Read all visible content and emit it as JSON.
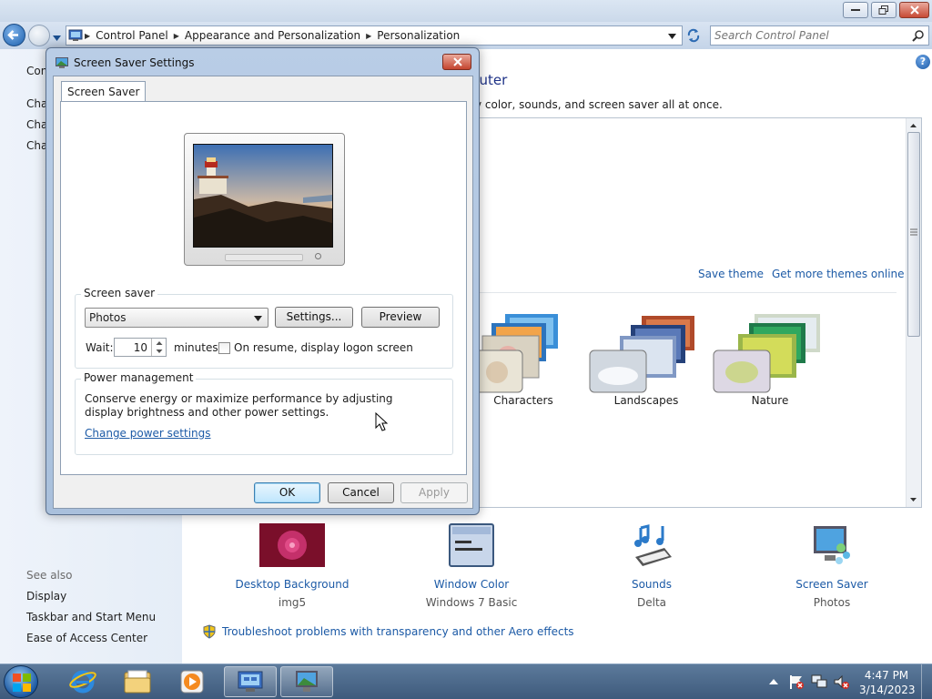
{
  "explorer": {
    "breadcrumbs": [
      "Control Panel",
      "Appearance and Personalization",
      "Personalization"
    ],
    "search_placeholder": "Search Control Panel",
    "left_links": [
      "Con",
      "Cha",
      "Cha",
      "Cha"
    ],
    "see_also": {
      "heading": "See also",
      "links": [
        "Display",
        "Taskbar and Start Menu",
        "Ease of Access Center"
      ]
    },
    "heading_partial": "puter",
    "subheading_partial": "v color, sounds, and screen saver all at once.",
    "save_theme": "Save theme",
    "get_more_themes": "Get more themes online",
    "themes": [
      {
        "label": "Characters"
      },
      {
        "label": "Landscapes"
      },
      {
        "label": "Nature"
      }
    ],
    "bottom_items": [
      {
        "label": "Desktop Background",
        "value": "img5"
      },
      {
        "label": "Window Color",
        "value": "Windows 7 Basic"
      },
      {
        "label": "Sounds",
        "value": "Delta"
      },
      {
        "label": "Screen Saver",
        "value": "Photos"
      }
    ],
    "troubleshoot_link": "Troubleshoot problems with transparency and other Aero effects"
  },
  "dialog": {
    "title": "Screen Saver Settings",
    "tab": "Screen Saver",
    "screensaver_group": "Screen saver",
    "selected_screensaver": "Photos",
    "settings_button": "Settings...",
    "preview_button": "Preview",
    "wait_label": "Wait:",
    "wait_value": "10",
    "minutes_label": "minutes",
    "resume_label": "On resume, display logon screen",
    "resume_checked": false,
    "power_group": "Power management",
    "power_text": "Conserve energy or maximize performance by adjusting display brightness and other power settings.",
    "power_link": "Change power settings",
    "ok": "OK",
    "cancel": "Cancel",
    "apply": "Apply"
  },
  "taskbar": {
    "time": "4:47 PM",
    "date": "3/14/2023"
  },
  "colors": {
    "link_blue": "#1c5aa6",
    "heading_blue": "#1e3287",
    "taskbar": "#4a6a8e"
  }
}
